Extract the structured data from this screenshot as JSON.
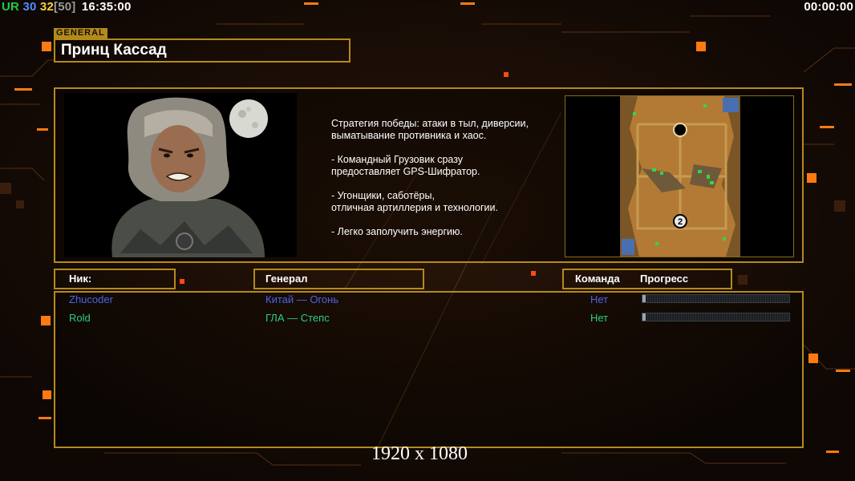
{
  "hud": {
    "ur_label": "UR",
    "ur_a": "30",
    "ur_b": "32",
    "ur_c": "[50]",
    "clock": "16:35:00",
    "timer": "00:00:00"
  },
  "general": {
    "tag": "GENERAL",
    "name": "Принц Кассад",
    "description": "Стратегия победы: атаки в тыл, диверсии,\n выматывание противника и хаос.\n\n- Командный Грузовик сразу\nпредоставляет GPS-Шифратор.\n\n- Угонщики, саботёры,\nотличная артиллерия и технологии.\n\n- Легко заполучить энергию."
  },
  "map": {
    "start_marker": "2"
  },
  "columns": {
    "nick": "Ник:",
    "general": "Генерал",
    "team": "Команда",
    "progress": "Прогресс"
  },
  "players": [
    {
      "nick": "Zhucoder",
      "general": "Китай — Огонь",
      "team": "Нет",
      "progress": 0.01,
      "color": "#4b63e8"
    },
    {
      "nick": "Rold",
      "general": "ГЛА — Степс",
      "team": "Нет",
      "progress": 0.01,
      "color": "#27d17f"
    }
  ],
  "watermark": "1920 x 1080",
  "colors": {
    "accent": "#b48a1c",
    "glow": "#ff7a12",
    "ur": "#22c84a",
    "val_a": "#4f8fff",
    "val_b": "#f6d23c",
    "val_c": "#9a9a9a"
  }
}
